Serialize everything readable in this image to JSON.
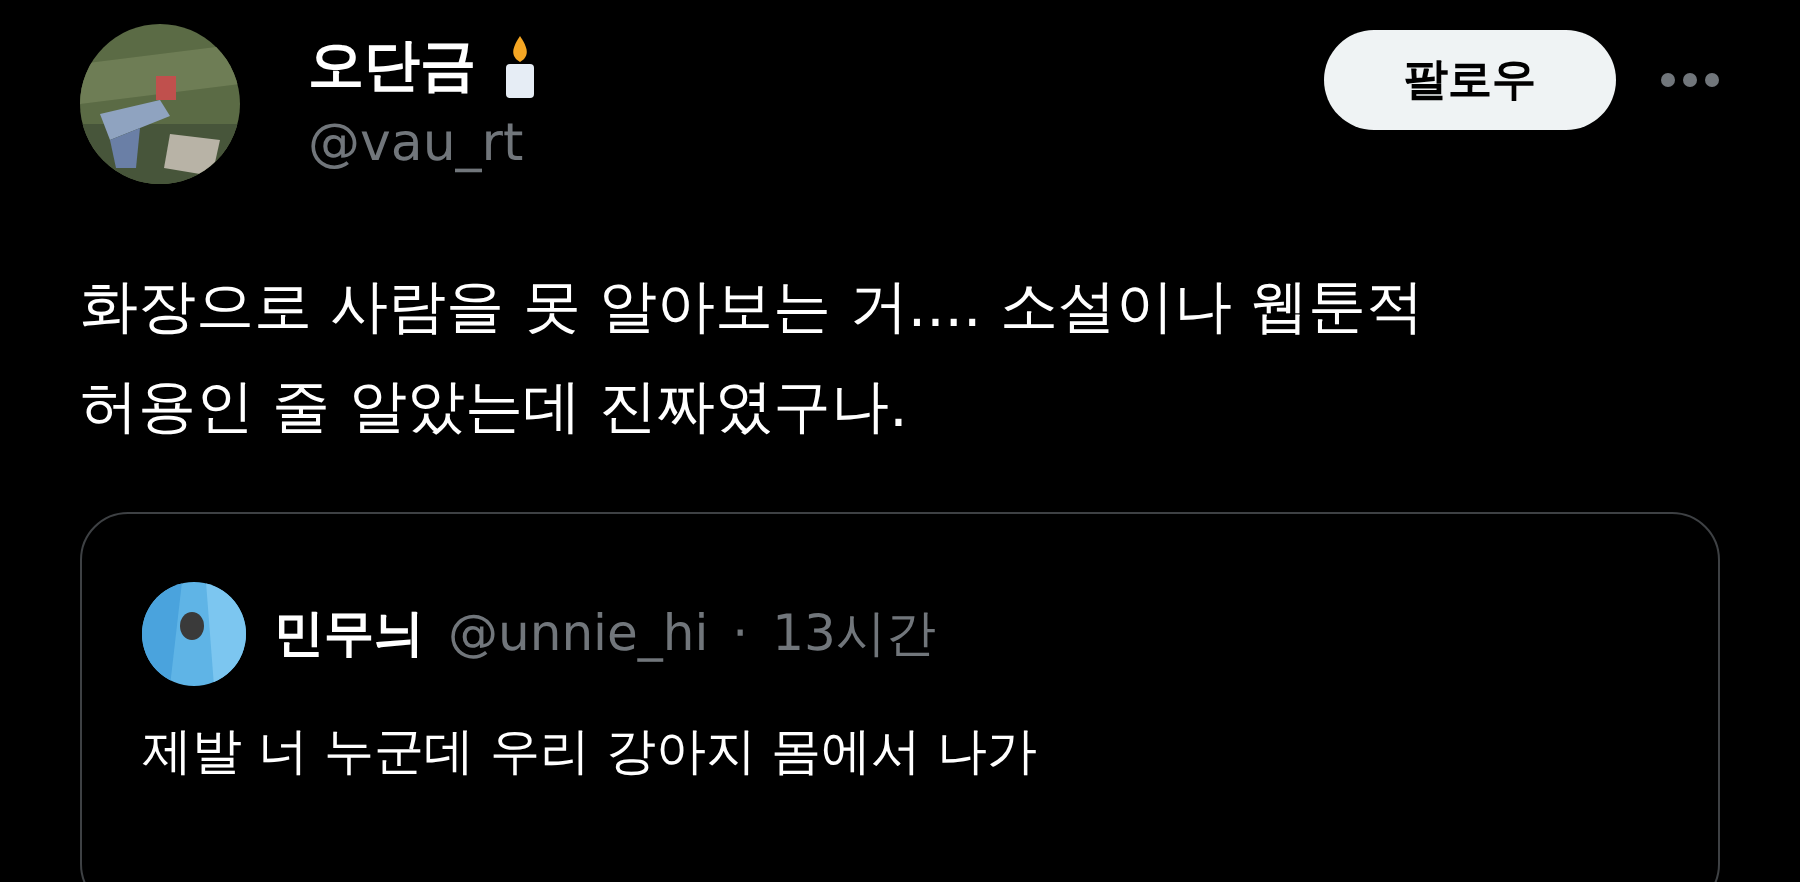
{
  "author": {
    "name": "오단금",
    "handle": "@vau_rt"
  },
  "follow_button": "팔로우",
  "tweet_lines": [
    "화장으로 사람을 못 알아보는 거.... 소설이나 웹툰적",
    "허용인 줄 알았는데 진짜였구나."
  ],
  "quoted_tweet": {
    "name": "민무늬",
    "handle": "@unnie_hi",
    "separator": "·",
    "time": "13시간",
    "text": "제발 너 누군데 우리 강아지 몸에서 나가"
  }
}
